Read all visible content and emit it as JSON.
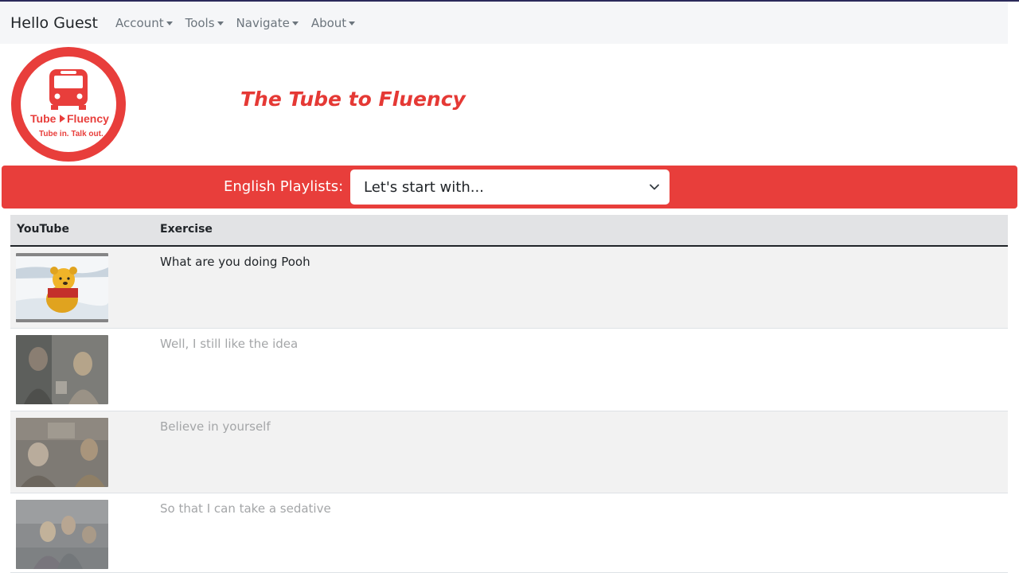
{
  "navbar": {
    "brand": "Hello Guest",
    "menus": [
      {
        "label": "Account"
      },
      {
        "label": "Tools"
      },
      {
        "label": "Navigate"
      },
      {
        "label": "About"
      }
    ]
  },
  "logo": {
    "line1_left": "Tube",
    "line1_right": "Fluency",
    "line2": "Tube in. Talk out."
  },
  "site_title": "The Tube to Fluency",
  "playlist": {
    "label": "English Playlists:",
    "selected": "Let's start with..."
  },
  "table": {
    "headers": {
      "youtube": "YouTube",
      "exercise": "Exercise"
    },
    "rows": [
      {
        "exercise": "What are you doing Pooh",
        "thumbnail": "winnie-the-pooh-snow-scene"
      },
      {
        "exercise": "Well, I still like the idea",
        "thumbnail": "movie-scene-two-people"
      },
      {
        "exercise": "Believe in yourself",
        "thumbnail": "movie-scene-elderly-woman-and-boy"
      },
      {
        "exercise": "So that I can take a sedative",
        "thumbnail": "movie-scene-people-on-plane"
      }
    ]
  },
  "colors": {
    "brand_red": "#e83e3b",
    "title_red": "#e53935",
    "navbar_bg": "#f5f6f8"
  }
}
